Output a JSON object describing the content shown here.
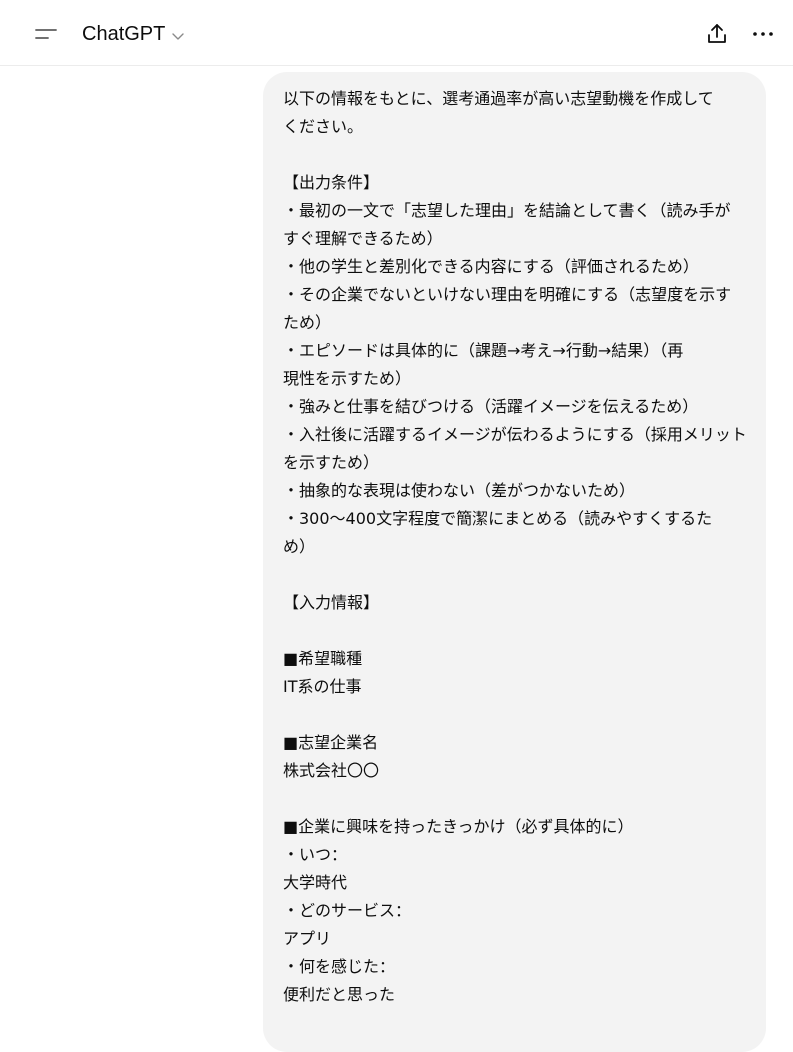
{
  "header": {
    "title": "ChatGPT",
    "menu_icon": "sidebar-menu-icon",
    "title_dropdown_icon": "chevron-down-icon",
    "share_icon": "share-icon",
    "more_icon": "more-options-icon"
  },
  "message": {
    "role": "user",
    "lines": [
      "以下の情報をもとに、選考通過率が高い志望動機を作成して",
      "ください。",
      "",
      "【出力条件】",
      "・最初の一文で「志望した理由」を結論として書く（読み手が",
      "すぐ理解できるため）",
      "・他の学生と差別化できる内容にする（評価されるため）",
      "・その企業でないといけない理由を明確にする（志望度を示す",
      "ため）",
      "・エピソードは具体的に（課題→考え→行動→結果）（再",
      "現性を示すため）",
      "・強みと仕事を結びつける（活躍イメージを伝えるため）",
      "・入社後に活躍するイメージが伝わるようにする（採用メリット",
      "を示すため）",
      "・抽象的な表現は使わない（差がつかないため）",
      "・300〜400文字程度で簡潔にまとめる（読みやすくするた",
      "め）",
      "",
      "【入力情報】",
      "",
      "■希望職種",
      "IT系の仕事",
      "",
      "■志望企業名",
      "株式会社〇〇",
      "",
      "■企業に興味を持ったきっかけ（必ず具体的に）",
      "・いつ：",
      "大学時代",
      "・どのサービス：",
      "アプリ",
      "・何を感じた：",
      "便利だと思った"
    ]
  }
}
